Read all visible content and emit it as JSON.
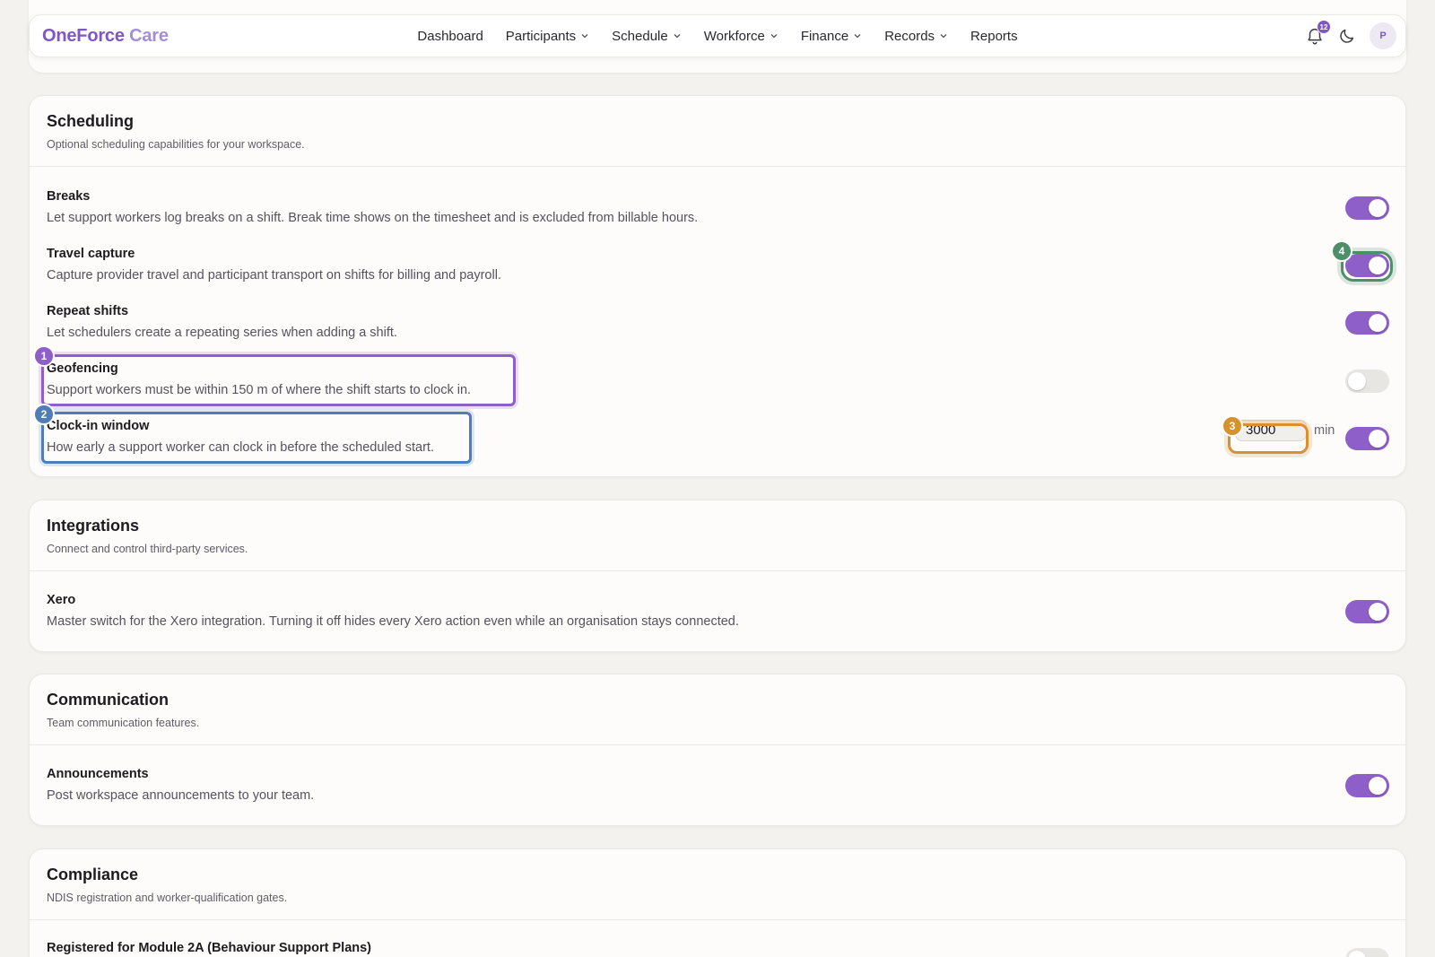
{
  "brand": {
    "part1": "OneForce",
    "part2": "Care"
  },
  "nav": {
    "items": [
      {
        "label": "Dashboard",
        "has_menu": false
      },
      {
        "label": "Participants",
        "has_menu": true
      },
      {
        "label": "Schedule",
        "has_menu": true
      },
      {
        "label": "Workforce",
        "has_menu": true
      },
      {
        "label": "Finance",
        "has_menu": true
      },
      {
        "label": "Records",
        "has_menu": true
      },
      {
        "label": "Reports",
        "has_menu": false
      }
    ],
    "notifications_count": "12",
    "avatar_initial": "P"
  },
  "sections": {
    "scheduling": {
      "title": "Scheduling",
      "subtitle": "Optional scheduling capabilities for your workspace.",
      "rows": [
        {
          "title": "Breaks",
          "desc": "Let support workers log breaks on a shift. Break time shows on the timesheet and is excluded from billable hours.",
          "enabled": true
        },
        {
          "title": "Travel capture",
          "desc": "Capture provider travel and participant transport on shifts for billing and payroll.",
          "enabled": true
        },
        {
          "title": "Repeat shifts",
          "desc": "Let schedulers create a repeating series when adding a shift.",
          "enabled": true
        },
        {
          "title": "Geofencing",
          "desc": "Support workers must be within 150 m of where the shift starts to clock in.",
          "enabled": false
        },
        {
          "title": "Clock-in window",
          "desc": "How early a support worker can clock in before the scheduled start.",
          "enabled": true,
          "value": "3000",
          "unit": "min"
        }
      ]
    },
    "integrations": {
      "title": "Integrations",
      "subtitle": "Connect and control third-party services.",
      "rows": [
        {
          "title": "Xero",
          "desc": "Master switch for the Xero integration. Turning it off hides every Xero action even while an organisation stays connected.",
          "enabled": true
        }
      ]
    },
    "communication": {
      "title": "Communication",
      "subtitle": "Team communication features.",
      "rows": [
        {
          "title": "Announcements",
          "desc": "Post workspace announcements to your team.",
          "enabled": true
        }
      ]
    },
    "compliance": {
      "title": "Compliance",
      "subtitle": "NDIS registration and worker-qualification gates.",
      "rows": [
        {
          "title": "Registered for Module 2A (Behaviour Support Plans)",
          "enabled": false
        }
      ]
    }
  },
  "markers": [
    "1",
    "2",
    "3",
    "4"
  ],
  "colors": {
    "accent": "#8e5fc9",
    "marker_blue": "#4f7db8",
    "marker_orange": "#d9912f",
    "marker_green": "#4e8f6a"
  }
}
